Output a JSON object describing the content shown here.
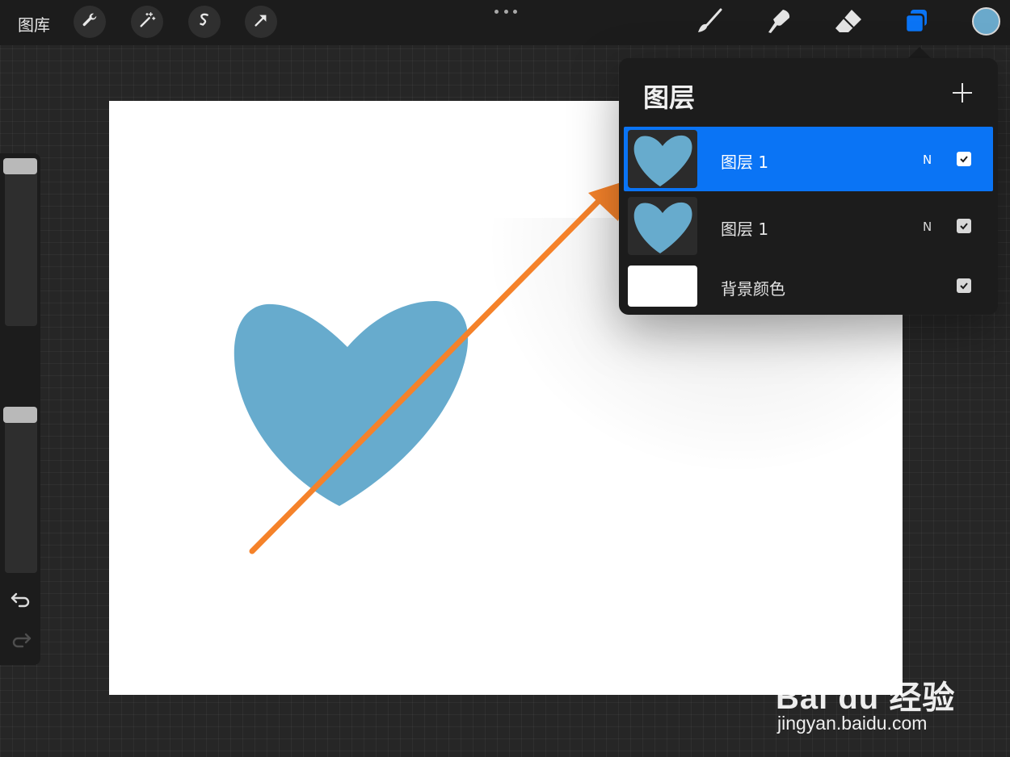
{
  "topbar": {
    "gallery_label": "图库",
    "left_tools": [
      "wrench-icon",
      "magic-wand-icon",
      "selection-icon",
      "transform-arrow-icon"
    ],
    "right_tools": [
      "brush-icon",
      "smudge-icon",
      "eraser-icon",
      "layers-icon"
    ],
    "current_color": "#6aa9cb",
    "active_tool_color": "#0a74f5"
  },
  "layers_panel": {
    "title": "图层",
    "layers": [
      {
        "name": "图层 1",
        "blend_mode": "N",
        "visible": true,
        "selected": true,
        "thumbnail": "blue-heart"
      },
      {
        "name": "图层 1",
        "blend_mode": "N",
        "visible": true,
        "selected": false,
        "thumbnail": "blue-heart"
      },
      {
        "name": "背景颜色",
        "blend_mode": "",
        "visible": true,
        "selected": false,
        "thumbnail": "white"
      }
    ]
  },
  "canvas": {
    "background": "#ffffff",
    "shape_color": "#67abcd",
    "annotation_arrow_color": "#f5822a"
  },
  "watermark": {
    "logo_text": "Bai du 经验",
    "url": "jingyan.baidu.com"
  }
}
